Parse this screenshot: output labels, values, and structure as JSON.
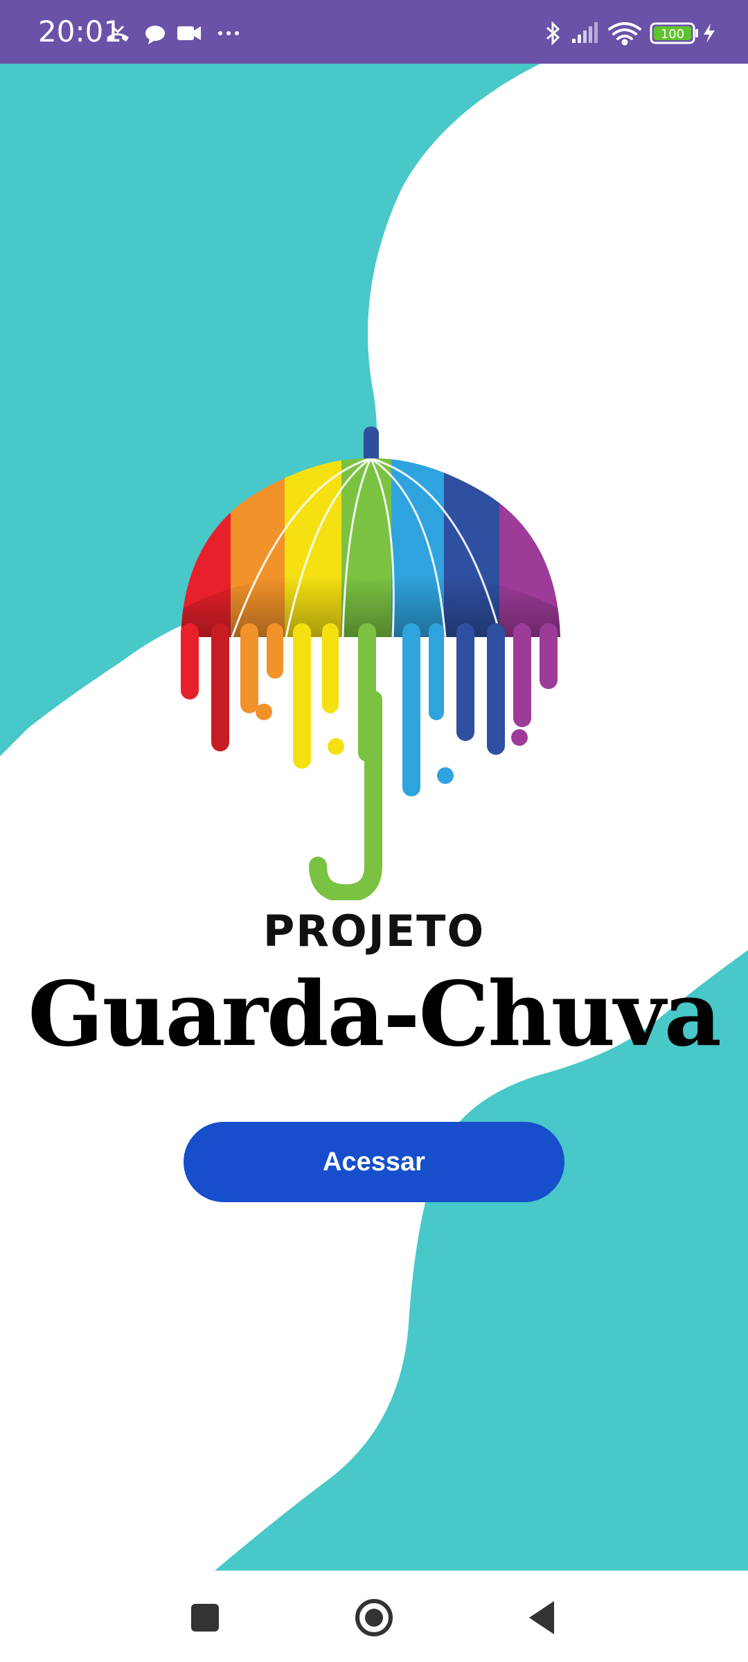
{
  "status_bar": {
    "time": "20:01",
    "battery_level": "100",
    "left_icons": [
      "missed-call-icon",
      "chat-bubble-icon",
      "video-camera-icon",
      "more-dots-icon"
    ],
    "right_icons": [
      "bluetooth-icon",
      "signal-icon",
      "wifi-icon",
      "battery-icon",
      "charging-icon"
    ]
  },
  "brand": {
    "kicker": "PROJETO",
    "title": "Guarda-Chuva"
  },
  "actions": {
    "access_label": "Acessar"
  },
  "colors": {
    "status_bar": "#6a52a8",
    "teal": "#48c8c8",
    "button": "#164ecb"
  },
  "navigation": {
    "buttons": [
      "recent-apps-icon",
      "home-icon",
      "back-icon"
    ]
  }
}
